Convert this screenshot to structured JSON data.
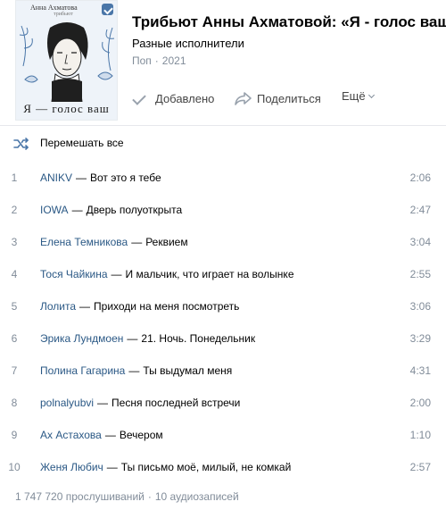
{
  "album": {
    "cover": {
      "author": "Анна Ахматова",
      "subtitle": "трибьют",
      "caption": "Я — голос ваш"
    },
    "title": "Трибьют Анны Ахматовой: «Я - голос ваш»",
    "artist": "Разные исполнители",
    "genre": "Поп",
    "separator": "·",
    "year": "2021"
  },
  "actions": {
    "added": "Добавлено",
    "share": "Поделиться",
    "more": "Ещё"
  },
  "shuffle_label": "Перемешать все",
  "tracks": [
    {
      "num": "1",
      "artist": "ANIKV",
      "title": "Вот это я тебе",
      "duration": "2:06"
    },
    {
      "num": "2",
      "artist": "IOWA",
      "title": "Дверь полуоткрыта",
      "duration": "2:47"
    },
    {
      "num": "3",
      "artist": "Елена Темникова",
      "title": "Реквием",
      "duration": "3:04"
    },
    {
      "num": "4",
      "artist": "Тося Чайкина",
      "title": "И мальчик, что играет на волынке",
      "duration": "2:55"
    },
    {
      "num": "5",
      "artist": "Лолита",
      "title": "Приходи на меня посмотреть",
      "duration": "3:06"
    },
    {
      "num": "6",
      "artist": "Эрика Лундмоен",
      "title": "21. Ночь. Понедельник",
      "duration": "3:29"
    },
    {
      "num": "7",
      "artist": "Полина Гагарина",
      "title": "Ты выдумал меня",
      "duration": "4:31"
    },
    {
      "num": "8",
      "artist": "polnalyubvi",
      "title": "Песня последней встречи",
      "duration": "2:00"
    },
    {
      "num": "9",
      "artist": "Ах Астахова",
      "title": "Вечером",
      "duration": "1:10"
    },
    {
      "num": "10",
      "artist": "Женя Любич",
      "title": "Ты письмо моё, милый, не комкай",
      "duration": "2:57"
    }
  ],
  "footer": {
    "listens": "1 747 720 прослушиваний",
    "separator": "·",
    "count": "10 аудиозаписей"
  },
  "colors": {
    "link": "#2a5885",
    "muted": "#818c99",
    "icon": "#99a2ad",
    "divider": "#e7e8ec",
    "cover_lines": "#4a76a8"
  },
  "icons": {
    "added": "check-icon",
    "share": "share-arrow-icon",
    "more": "chevron-down-icon",
    "shuffle": "shuffle-icon",
    "vk": "vk-logo-icon"
  }
}
